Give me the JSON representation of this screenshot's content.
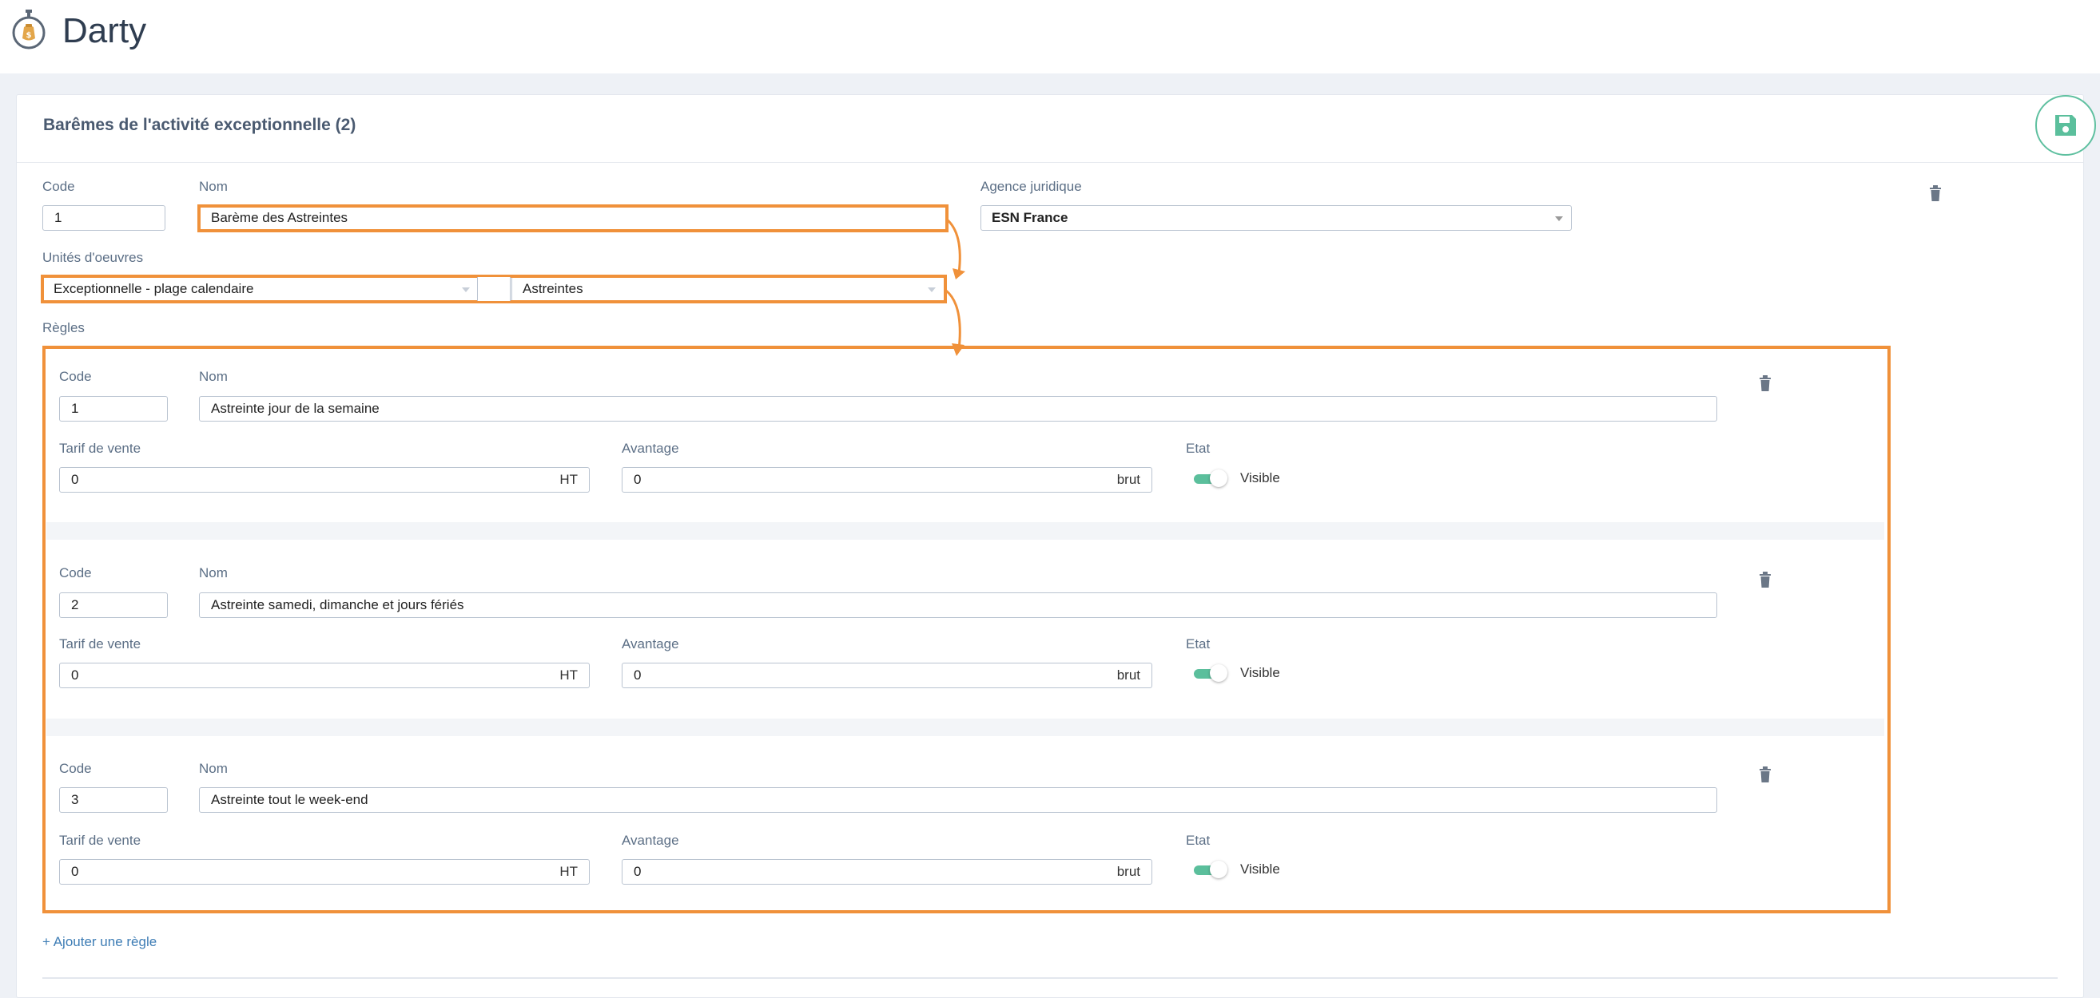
{
  "app": {
    "title": "Darty",
    "logo_icon": "stopwatch-money-icon"
  },
  "panel": {
    "title": "Barêmes de l'activité exceptionnelle (2)",
    "save_icon": "floppy-disk-icon"
  },
  "bareme": {
    "code_label": "Code",
    "code_value": "1",
    "nom_label": "Nom",
    "nom_value": "Barème des Astreintes",
    "agence_label": "Agence juridique",
    "agence_value": "ESN France",
    "unites_label": "Unités d'oeuvres",
    "unite_type": "Exceptionnelle - plage calendaire",
    "unite_value": "Astreintes",
    "regles_label": "Règles"
  },
  "rules": [
    {
      "code_label": "Code",
      "code": "1",
      "nom_label": "Nom",
      "nom": "Astreinte jour de la semaine",
      "tarif_label": "Tarif de vente",
      "tarif": "0",
      "tarif_unit": "HT",
      "avantage_label": "Avantage",
      "avantage": "0",
      "avantage_unit": "brut",
      "etat_label": "Etat",
      "etat": "Visible"
    },
    {
      "code_label": "Code",
      "code": "2",
      "nom_label": "Nom",
      "nom": "Astreinte samedi, dimanche et jours fériés",
      "tarif_label": "Tarif de vente",
      "tarif": "0",
      "tarif_unit": "HT",
      "avantage_label": "Avantage",
      "avantage": "0",
      "avantage_unit": "brut",
      "etat_label": "Etat",
      "etat": "Visible"
    },
    {
      "code_label": "Code",
      "code": "3",
      "nom_label": "Nom",
      "nom": "Astreinte tout le week-end",
      "tarif_label": "Tarif de vente",
      "tarif": "0",
      "tarif_unit": "HT",
      "avantage_label": "Avantage",
      "avantage": "0",
      "avantage_unit": "brut",
      "etat_label": "Etat",
      "etat": "Visible"
    }
  ],
  "add_rule_label": "+ Ajouter une règle",
  "colors": {
    "highlight": "#f0913a",
    "accent": "#5bbf9c",
    "link": "#3e7db5"
  }
}
